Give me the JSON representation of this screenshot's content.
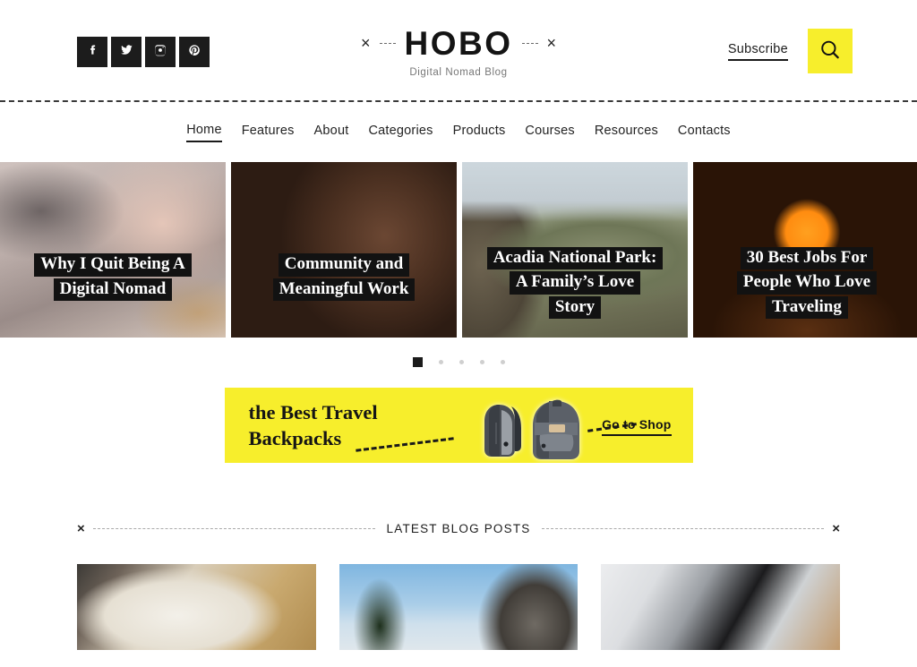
{
  "site": {
    "logo_x_left": "×",
    "logo_x_right": "×",
    "logo_text": "HOBO",
    "logo_tagline": "Digital Nomad Blog"
  },
  "header": {
    "social": [
      {
        "name": "facebook-icon",
        "label": "Facebook"
      },
      {
        "name": "twitter-icon",
        "label": "Twitter"
      },
      {
        "name": "instagram-icon",
        "label": "Instagram"
      },
      {
        "name": "pinterest-icon",
        "label": "Pinterest"
      }
    ],
    "subscribe_label": "Subscribe",
    "search_icon": "search-icon",
    "search_button_color": "#F7EE2C"
  },
  "nav": {
    "items": [
      {
        "label": "Home",
        "active": true
      },
      {
        "label": "Features",
        "active": false
      },
      {
        "label": "About",
        "active": false
      },
      {
        "label": "Categories",
        "active": false
      },
      {
        "label": "Products",
        "active": false
      },
      {
        "label": "Courses",
        "active": false
      },
      {
        "label": "Resources",
        "active": false
      },
      {
        "label": "Contacts",
        "active": false
      }
    ]
  },
  "carousel": {
    "slides": [
      {
        "title_lines": [
          "Why I Quit Being A",
          "Digital Nomad"
        ],
        "image_alt": "hands typing on a laptop keyboard"
      },
      {
        "title_lines": [
          "Community and",
          "Meaningful Work"
        ],
        "image_alt": "smiling woman embracing a friend"
      },
      {
        "title_lines": [
          "Acadia National Park:",
          "A Family’s Love",
          "Story"
        ],
        "image_alt": "hiker seated overlooking a green mountain valley"
      },
      {
        "title_lines": [
          "30 Best Jobs For",
          "People Who Love",
          "Traveling"
        ],
        "image_alt": "silhouette of a person against an orange sunset"
      }
    ],
    "dots": [
      {
        "active": true
      },
      {
        "active": false
      },
      {
        "active": false
      },
      {
        "active": false
      },
      {
        "active": false
      }
    ]
  },
  "banner": {
    "line1": "the Best Travel",
    "line2": "Backpacks",
    "cta_label": "Go to Shop",
    "background_color": "#F7EE2C",
    "product_alt": "two gray travel backpacks"
  },
  "latest": {
    "left_x": "×",
    "right_x": "×",
    "title": "LATEST BLOG POSTS",
    "posts": [
      {
        "image_alt": "open notebook and pen on a wooden desk"
      },
      {
        "image_alt": "pine tree and granite cliff under blue sky"
      },
      {
        "image_alt": "person holding a black tablet device"
      }
    ]
  }
}
